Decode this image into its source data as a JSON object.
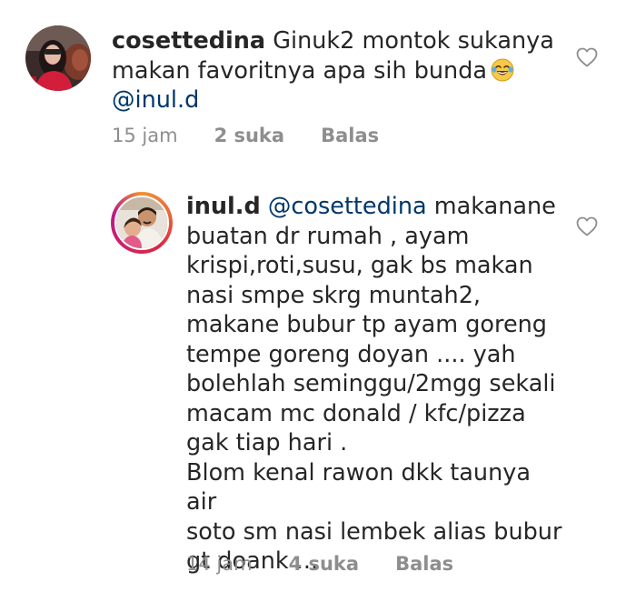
{
  "comments": [
    {
      "username": "cosettedina",
      "text_lines": [
        "Ginuk2 montok sukanya",
        "makan favoritnya apa sih bunda"
      ],
      "emoji": "tears-of-joy",
      "mention": "@inul.d",
      "time": "15 jam",
      "likes": "2 suka",
      "reply": "Balas"
    },
    {
      "username": "inul.d",
      "mention": "@cosettedina",
      "first_line_text": "makanane",
      "text_lines": [
        "buatan dr rumah , ayam",
        "krispi,roti,susu, gak bs makan",
        "nasi smpe skrg muntah2,",
        "makane bubur tp ayam goreng",
        "tempe goreng doyan .... yah",
        "bolehlah seminggu/2mgg sekali",
        "macam mc donald / kfc/pizza",
        "gak tiap hari .",
        "Blom kenal rawon dkk taunya air",
        "soto sm nasi lembek alias bubur",
        "gt doank ..."
      ],
      "time": "14 jam",
      "likes": "4 suka",
      "reply": "Balas"
    }
  ],
  "icons": {
    "like": "heart-outline-icon"
  },
  "colors": {
    "text": "#262626",
    "muted": "#8e8e8e",
    "mention": "#00376b"
  }
}
